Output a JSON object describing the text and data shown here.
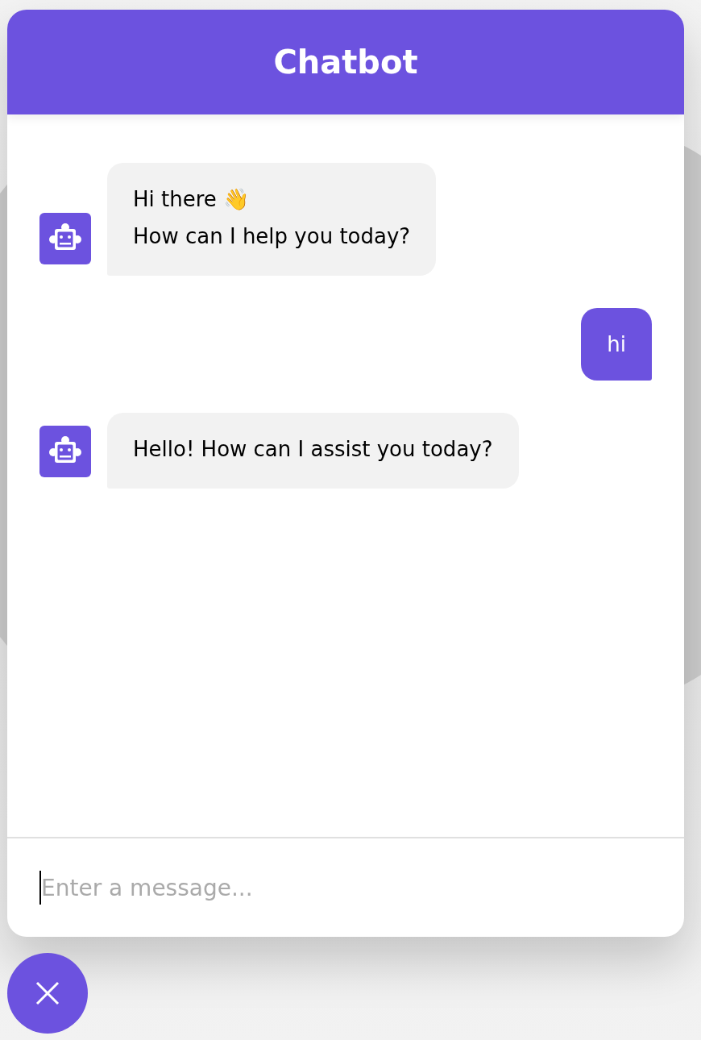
{
  "header": {
    "title": "Chatbot"
  },
  "messages": [
    {
      "kind": "bot",
      "lines": [
        "Hi there 👋",
        "How can I help you today?"
      ]
    },
    {
      "kind": "user",
      "lines": [
        "hi"
      ]
    },
    {
      "kind": "bot",
      "lines": [
        "Hello! How can I assist you today?"
      ]
    }
  ],
  "input": {
    "placeholder": "Enter a message...",
    "focused": true
  },
  "toggler": {
    "open": true
  }
}
